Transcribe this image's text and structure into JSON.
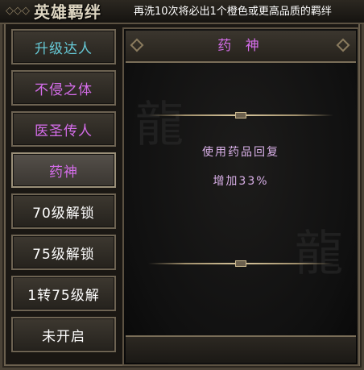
{
  "header": {
    "title": "英雄羁绊",
    "tip": "再洗10次将必出1个橙色或更高品质的羁绊"
  },
  "menu": {
    "items": [
      {
        "label": "升级达人",
        "color": "#66c9d6"
      },
      {
        "label": "不侵之体",
        "color": "#d56dea"
      },
      {
        "label": "医圣传人",
        "color": "#d56dea"
      },
      {
        "label": "药神",
        "color": "#d56dea",
        "selected": true
      },
      {
        "label": "70级解锁",
        "color": "#ffffff"
      },
      {
        "label": "75级解锁",
        "color": "#ffffff"
      },
      {
        "label": "1转75级解",
        "color": "#ffffff"
      },
      {
        "label": "未开启",
        "color": "#ffffff"
      }
    ]
  },
  "detail": {
    "title": "药 神",
    "effect_line1": "使用药品回复",
    "effect_line2": "增加33%"
  }
}
